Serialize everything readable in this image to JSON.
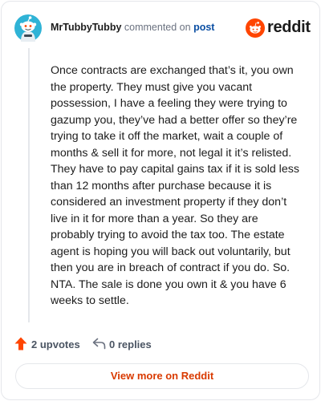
{
  "header": {
    "username": "MrTubbyTubby",
    "verb": "commented on",
    "post_link": "post",
    "brand": "reddit"
  },
  "comment": {
    "body": "Once contracts are exchanged that’s it, you own the property. They must give you vacant possession, I have a feeling they were trying to gazump you, they’ve had a better offer so they’re trying to take it off the market, wait a couple of months & sell it for more, not legal it it’s relisted. They have to pay capital gains tax if it is sold less than 12 months after purchase because it is considered an investment property if they don’t live in it for more than a year. So they are probably trying to avoid the tax too. The estate agent is hoping you will back out voluntarily, but then you are in breach of contract if you do. So. NTA. The sale is done you own it & you have 6 weeks to settle."
  },
  "actions": {
    "upvotes": "2 upvotes",
    "replies": "0 replies"
  },
  "footer": {
    "view_more": "View more on Reddit"
  },
  "icons": {
    "avatar": "snoo-avatar-icon",
    "brand": "reddit-logo-icon",
    "upvote": "upvote-arrow-icon",
    "reply": "reply-icon"
  },
  "colors": {
    "brand_orange": "#ff4500",
    "link_blue": "#0b4fa3",
    "cta_orange": "#d93a00",
    "avatar_bg": "#2fb3d6"
  }
}
